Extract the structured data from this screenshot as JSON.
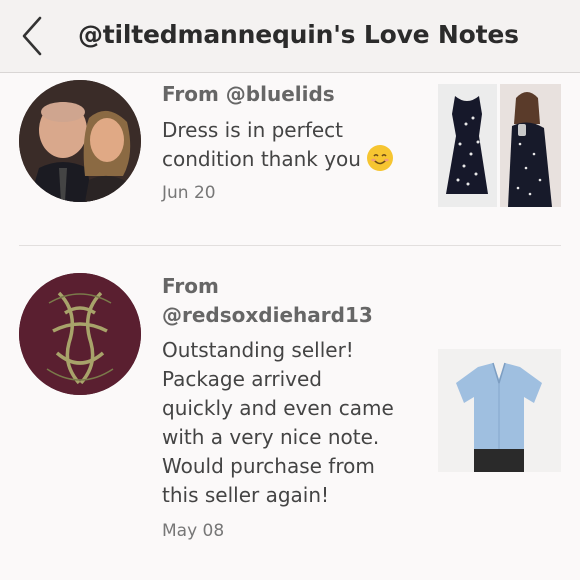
{
  "header": {
    "title": "@tiltedmannequin's Love Notes"
  },
  "notes": [
    {
      "from": "From @bluelids",
      "message": "Dress is in perfect condition thank you",
      "date": "Jun 20"
    },
    {
      "from_line1": "From",
      "from_line2": "@redsoxdiehard13",
      "message_lines": [
        "Outstanding seller!",
        "Package arrived",
        "quickly and even came",
        "with a very nice note.",
        "Would purchase from",
        "this seller again!"
      ],
      "date": "May 08"
    }
  ],
  "icons": {
    "back": "chevron-left-icon",
    "emoji": "smiling-face-emoji"
  },
  "colors": {
    "header_bg": "#f4f2f1",
    "page_bg": "#fbf9f9",
    "text": "#444444"
  }
}
